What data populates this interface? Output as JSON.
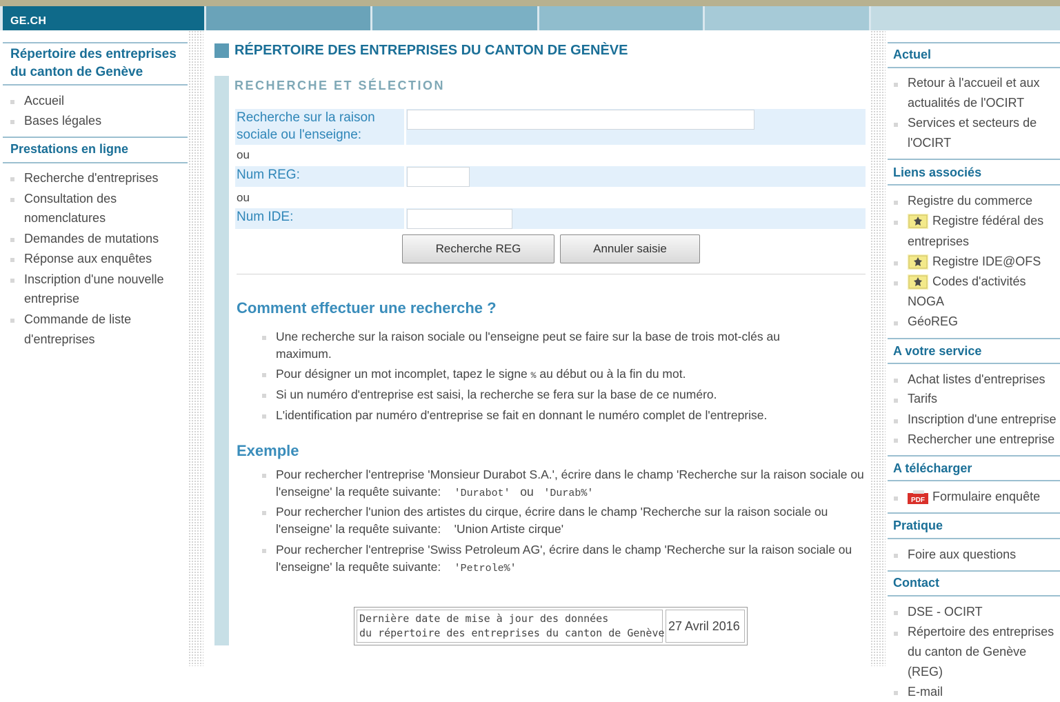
{
  "banner": {
    "brand": "GE.CH"
  },
  "left": {
    "title": "Répertoire des entreprises du canton de Genève",
    "nav1": [
      "Accueil",
      "Bases légales"
    ],
    "section": "Prestations en ligne",
    "nav2": [
      "Recherche d'entreprises",
      "Consultation des",
      "nomenclatures",
      "Demandes de mutations",
      "Réponse aux enquêtes",
      "Inscription d'une nouvelle",
      "entreprise",
      "Commande de liste",
      "d'entreprises"
    ]
  },
  "main": {
    "title": "RÉPERTOIRE DES ENTREPRISES DU CANTON DE GENÈVE",
    "subtitle": "RECHERCHE ET SÉLECTION",
    "form": {
      "label_raison": "Recherche sur la raison sociale ou l'enseigne:",
      "raison_value": "",
      "ou": "ou",
      "label_reg": "Num REG:",
      "reg_value": "",
      "label_ide": "Num IDE:",
      "ide_value": "",
      "search_button": "Recherche REG",
      "reset_button": "Annuler saisie"
    },
    "howto_title": "Comment effectuer une recherche ?",
    "howto": [
      "Une recherche sur la raison sociale ou l'enseigne peut se faire sur la base de trois mot-clés au maximum.",
      "Pour désigner un mot incomplet, tapez le signe",
      "%",
      "au début ou à la fin du mot.",
      "Si un numéro d'entreprise est saisi, la recherche se fera sur la base de ce numéro.",
      "L'identification par numéro d'entreprise se fait en donnant le numéro complet de l'entreprise."
    ],
    "example_title": "Exemple",
    "examples": {
      "e1": "Pour rechercher l'entreprise 'Monsieur Durabot S.A.', écrire dans le champ 'Recherche sur la raison sociale ou l'enseigne' la requête suivante:",
      "e1_code1": "'Durabot'",
      "e1_ou": "ou",
      "e1_code2": "'Durab%'",
      "e2": "Pour rechercher l'union des artistes du cirque, écrire dans le champ 'Recherche sur la raison sociale ou l'enseigne' la requête suivante:",
      "e2_code": "'Union Artiste cirque'",
      "e3": "Pour rechercher l'entreprise 'Swiss Petroleum AG', écrire dans le champ 'Recherche sur la raison sociale ou l'enseigne' la requête suivante:",
      "e3_code": "'Petrole%'"
    },
    "update": {
      "label_line1": "Dernière date de mise à jour des données",
      "label_line2": "du répertoire des entreprises du canton de Genève",
      "date": "27 Avril 2016"
    }
  },
  "right": {
    "actuel": {
      "title": "Actuel",
      "lines": [
        "Retour à l'accueil et aux",
        "actualités de l'OCIRT",
        "Services et secteurs de",
        "l'OCIRT"
      ]
    },
    "liens": {
      "title": "Liens associés",
      "lines": [
        "Registre du commerce",
        "Registre fédéral des",
        "entreprises",
        "Registre IDE@OFS",
        "Codes d'activités",
        "NOGA",
        "GéoREG"
      ]
    },
    "service": {
      "title": "A votre service",
      "lines": [
        "Achat listes d'entreprises",
        "Tarifs",
        "Inscription d'une entreprise",
        "Rechercher une entreprise"
      ]
    },
    "telecharger": {
      "title": "A télécharger",
      "lines": [
        "Formulaire enquête"
      ],
      "pdf_label": "PDF"
    },
    "pratique": {
      "title": "Pratique",
      "lines": [
        "Foire aux questions"
      ]
    },
    "contact": {
      "title": "Contact",
      "lines": [
        "DSE - OCIRT",
        "Répertoire des entreprises",
        "du canton de Genève",
        "(REG)",
        "E-mail"
      ]
    }
  }
}
